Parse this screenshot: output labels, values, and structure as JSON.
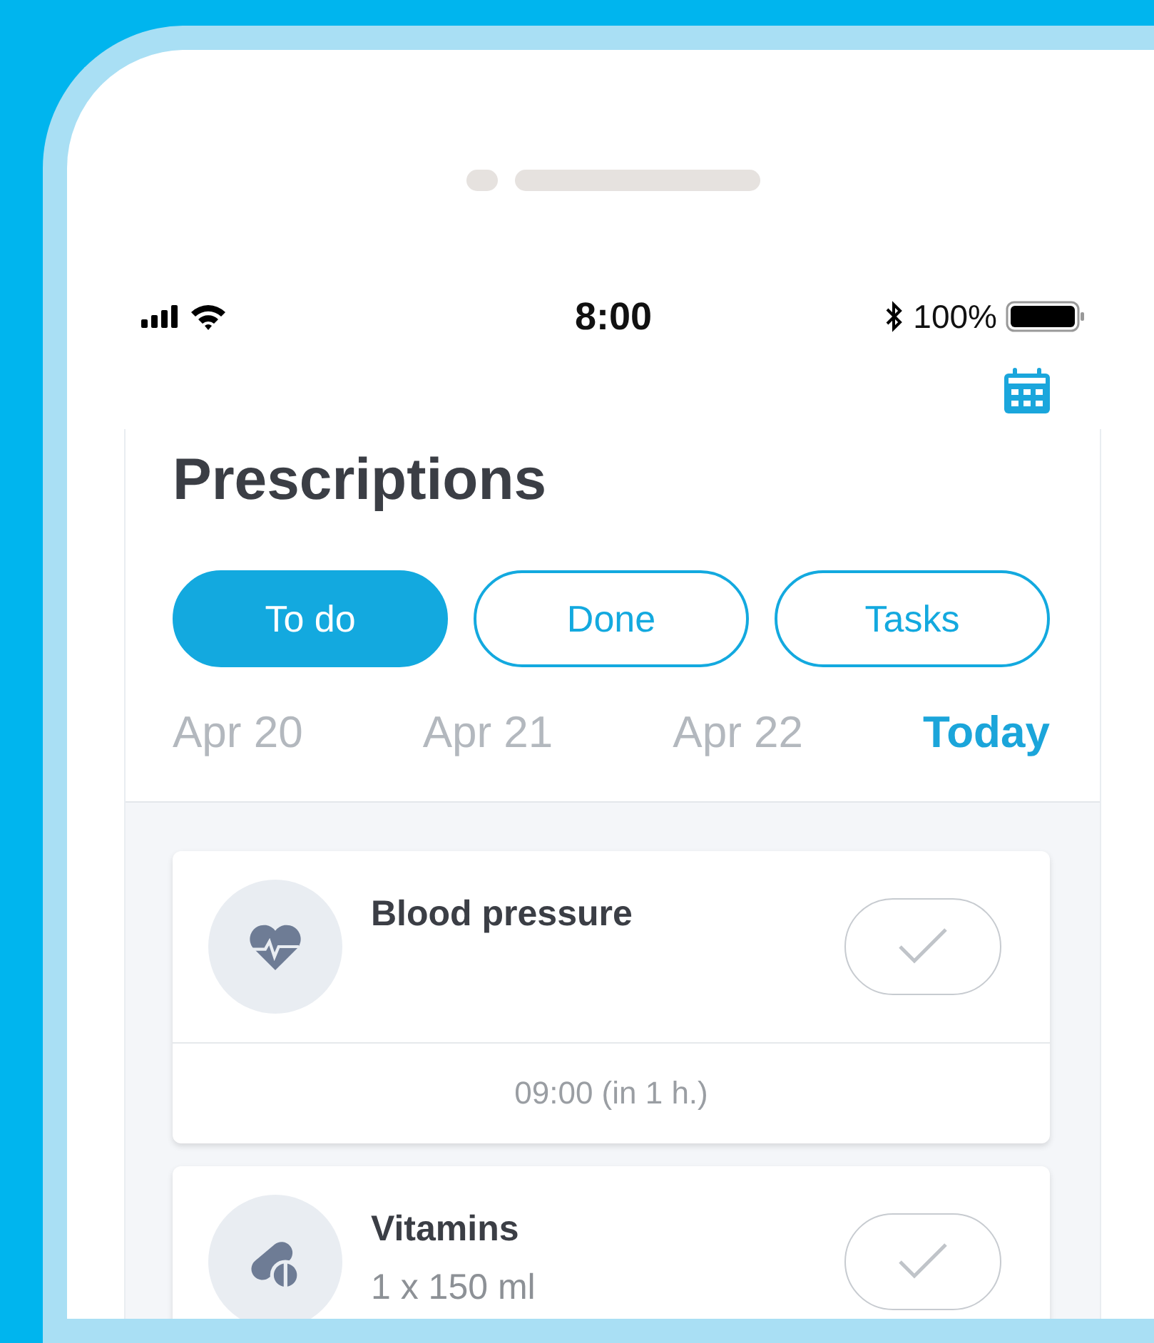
{
  "status_bar": {
    "time": "8:00",
    "battery": "100%"
  },
  "title": "Prescriptions",
  "filter_tabs": [
    {
      "label": "To do",
      "selected": true
    },
    {
      "label": "Done",
      "selected": false
    },
    {
      "label": "Tasks",
      "selected": false
    }
  ],
  "dates": [
    {
      "label": "Apr 20",
      "selected": false
    },
    {
      "label": "Apr 21",
      "selected": false
    },
    {
      "label": "Apr 22",
      "selected": false
    },
    {
      "label": "Today",
      "selected": true
    }
  ],
  "reminders": [
    {
      "kind": "heart",
      "name": "Blood pressure",
      "time": "09:00 (in 1 h.)",
      "done": false
    },
    {
      "kind": "pill",
      "name": "Vitamins",
      "dose": "1 x 150 ml",
      "done": false
    }
  ]
}
